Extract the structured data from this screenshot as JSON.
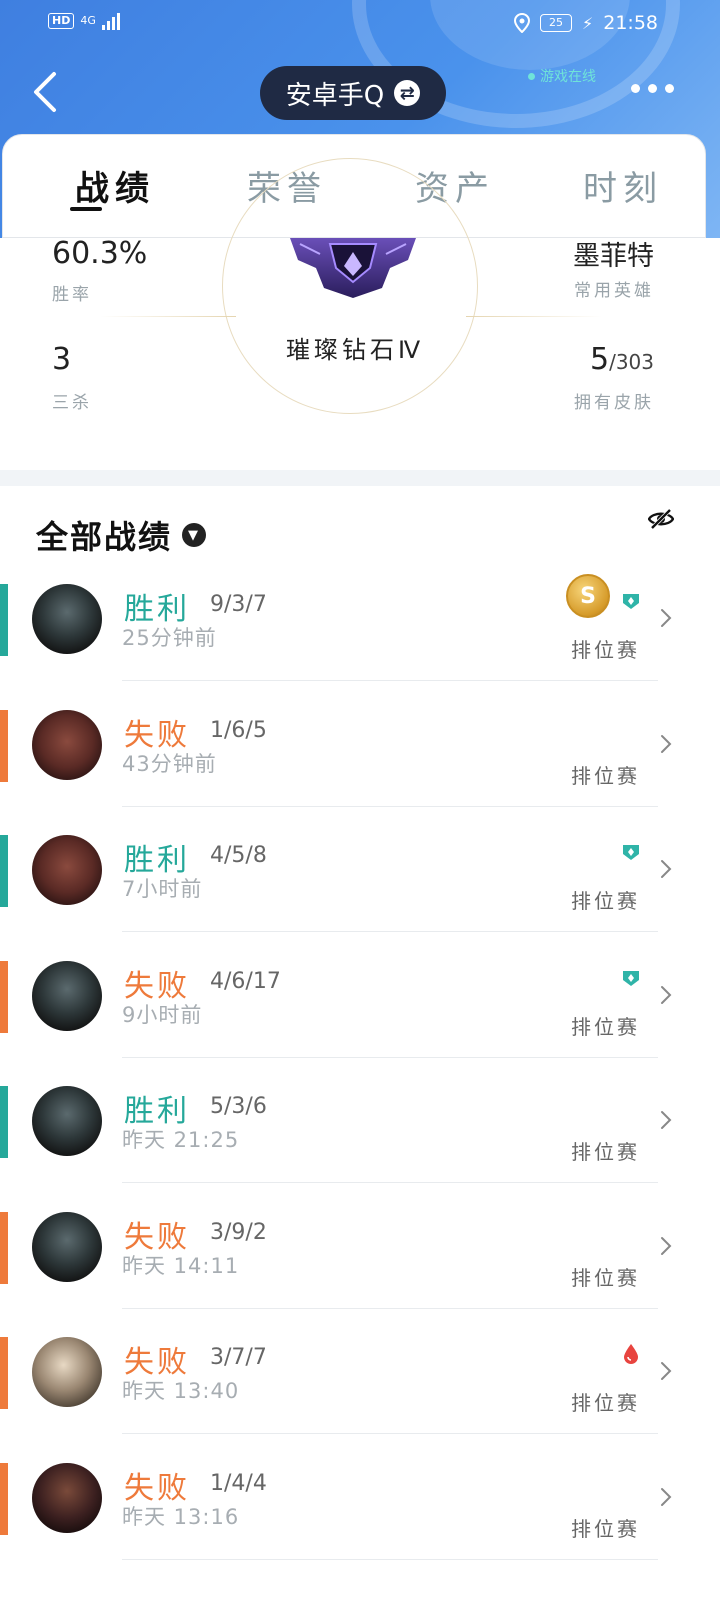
{
  "status_bar": {
    "hd": "HD",
    "network": "4G",
    "battery": "25",
    "time": "21:58"
  },
  "header": {
    "account_name": "安卓手Q",
    "online_status": "游戏在线"
  },
  "tabs": [
    {
      "label": "战绩",
      "active": true
    },
    {
      "label": "荣誉",
      "active": false
    },
    {
      "label": "资产",
      "active": false
    },
    {
      "label": "时刻",
      "active": false
    }
  ],
  "stats": {
    "win_rate": {
      "value": "60.3%",
      "label": "胜率"
    },
    "triple_kills": {
      "value": "3",
      "label": "三杀"
    },
    "favorite_hero": {
      "value": "墨菲特",
      "label": "常用英雄"
    },
    "skins": {
      "value": "5",
      "total": "/303",
      "label": "拥有皮肤"
    },
    "rank": "璀璨钻石Ⅳ"
  },
  "section": {
    "title": "全部战绩"
  },
  "colors": {
    "win": "#25a89a",
    "loss": "#ee7a3b",
    "header": "#3f7fe0"
  },
  "matches": [
    {
      "result": "胜利",
      "kda": "9/3/7",
      "time": "25分钟前",
      "mode": "排位赛",
      "outcome": "win",
      "hero_icon": "avatar-dark-armor",
      "badges": [
        "mvp-coin-icon",
        "shield-badge-icon"
      ]
    },
    {
      "result": "失败",
      "kda": "1/6/5",
      "time": "43分钟前",
      "mode": "排位赛",
      "outcome": "loss",
      "hero_icon": "avatar-rock",
      "badges": []
    },
    {
      "result": "胜利",
      "kda": "4/5/8",
      "time": "7小时前",
      "mode": "排位赛",
      "outcome": "win",
      "hero_icon": "avatar-rock",
      "badges": [
        "shield-badge-icon"
      ]
    },
    {
      "result": "失败",
      "kda": "4/6/17",
      "time": "9小时前",
      "mode": "排位赛",
      "outcome": "loss",
      "hero_icon": "avatar-dark-armor",
      "badges": [
        "shield-badge-icon"
      ]
    },
    {
      "result": "胜利",
      "kda": "5/3/6",
      "time": "昨天 21:25",
      "mode": "排位赛",
      "outcome": "win",
      "hero_icon": "avatar-dark-armor",
      "badges": []
    },
    {
      "result": "失败",
      "kda": "3/9/2",
      "time": "昨天 14:11",
      "mode": "排位赛",
      "outcome": "loss",
      "hero_icon": "avatar-dark-armor",
      "badges": []
    },
    {
      "result": "失败",
      "kda": "3/7/7",
      "time": "昨天 13:40",
      "mode": "排位赛",
      "outcome": "loss",
      "hero_icon": "avatar-light",
      "badges": [
        "blood-drop-icon"
      ]
    },
    {
      "result": "失败",
      "kda": "1/4/4",
      "time": "昨天 13:16",
      "mode": "排位赛",
      "outcome": "loss",
      "hero_icon": "avatar-portrait",
      "badges": []
    }
  ]
}
